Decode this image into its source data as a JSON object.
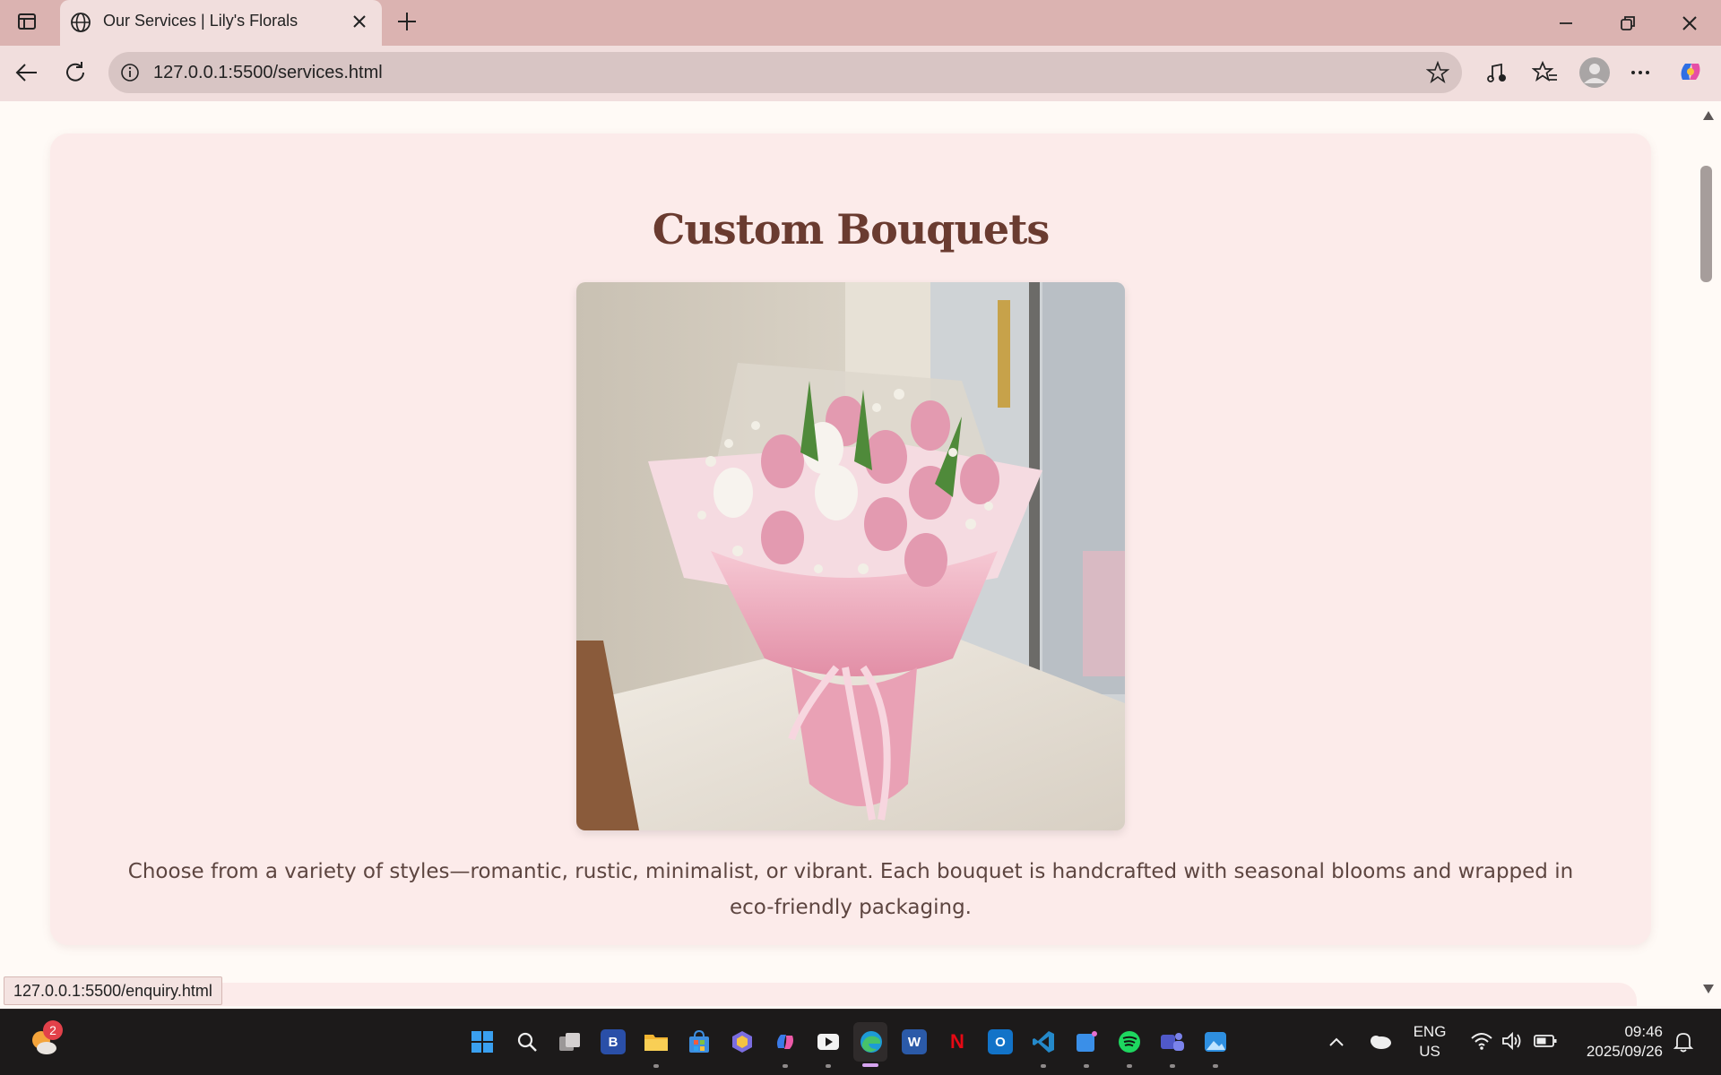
{
  "browser": {
    "tab_title": "Our Services | Lily's Florals",
    "url": "127.0.0.1:5500/services.html",
    "status_url": "127.0.0.1:5500/enquiry.html"
  },
  "page": {
    "heading": "Custom Bouquets",
    "image_alt": "Pink and white tulip bouquet with baby's breath by a window",
    "description": "Choose from a variety of styles—romantic, rustic, minimalist, or vibrant. Each bouquet is handcrafted with seasonal blooms and wrapped in eco-friendly packaging."
  },
  "taskbar": {
    "weather_badge": "2",
    "language_line1": "ENG",
    "language_line2": "US",
    "time": "09:46",
    "date": "2025/09/26",
    "apps": [
      "start-icon",
      "search-icon",
      "task-view-icon",
      "b-app-icon",
      "file-explorer-icon",
      "store-icon",
      "app-hex-icon",
      "copilot-icon",
      "media-icon",
      "edge-icon",
      "word-icon",
      "netflix-icon",
      "outlook-icon",
      "vscode-icon",
      "todo-icon",
      "spotify-icon",
      "teams-icon",
      "photos-icon"
    ]
  },
  "colors": {
    "titlebar": "#dbb3b1",
    "card_bg": "#fcebea",
    "heading": "#6a3b30",
    "text": "#5d4540"
  }
}
